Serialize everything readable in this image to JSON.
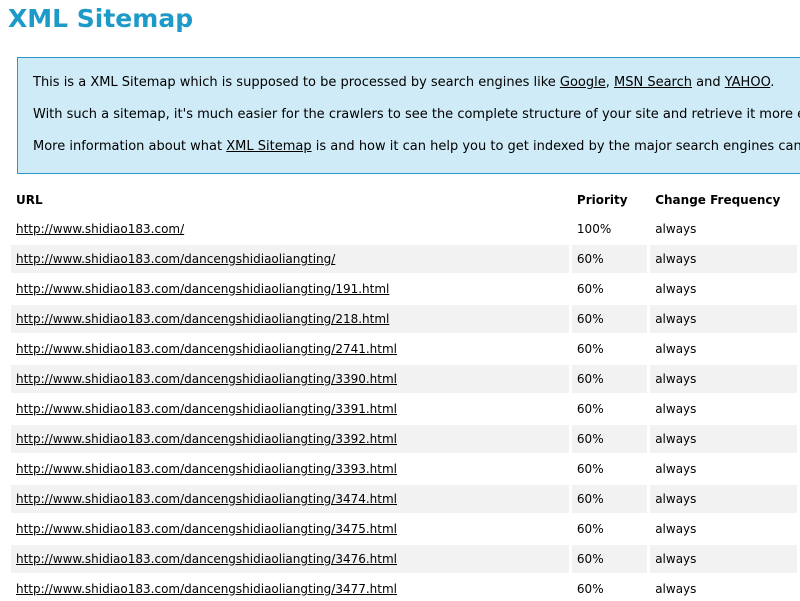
{
  "title": "XML Sitemap",
  "intro": {
    "line1": {
      "before": "This is a XML Sitemap which is supposed to be processed by search engines like ",
      "link1": "Google",
      "sep1": ", ",
      "link2": "MSN Search",
      "sep2": " and ",
      "link3": "YAHOO",
      "after": "."
    },
    "line2": "With such a sitemap, it's much easier for the crawlers to see the complete structure of your site and retrieve it more effici",
    "line3": {
      "before": "More information about what ",
      "link": "XML Sitemap",
      "after": " is and how it can help you to get indexed by the major search engines can be f"
    }
  },
  "table": {
    "headers": {
      "url": "URL",
      "priority": "Priority",
      "frequency": "Change Frequency"
    },
    "rows": [
      {
        "url": "http://www.shidiao183.com/",
        "priority": "100%",
        "frequency": "always"
      },
      {
        "url": "http://www.shidiao183.com/dancengshidiaoliangting/",
        "priority": "60%",
        "frequency": "always"
      },
      {
        "url": "http://www.shidiao183.com/dancengshidiaoliangting/191.html",
        "priority": "60%",
        "frequency": "always"
      },
      {
        "url": "http://www.shidiao183.com/dancengshidiaoliangting/218.html",
        "priority": "60%",
        "frequency": "always"
      },
      {
        "url": "http://www.shidiao183.com/dancengshidiaoliangting/2741.html",
        "priority": "60%",
        "frequency": "always"
      },
      {
        "url": "http://www.shidiao183.com/dancengshidiaoliangting/3390.html",
        "priority": "60%",
        "frequency": "always"
      },
      {
        "url": "http://www.shidiao183.com/dancengshidiaoliangting/3391.html",
        "priority": "60%",
        "frequency": "always"
      },
      {
        "url": "http://www.shidiao183.com/dancengshidiaoliangting/3392.html",
        "priority": "60%",
        "frequency": "always"
      },
      {
        "url": "http://www.shidiao183.com/dancengshidiaoliangting/3393.html",
        "priority": "60%",
        "frequency": "always"
      },
      {
        "url": "http://www.shidiao183.com/dancengshidiaoliangting/3474.html",
        "priority": "60%",
        "frequency": "always"
      },
      {
        "url": "http://www.shidiao183.com/dancengshidiaoliangting/3475.html",
        "priority": "60%",
        "frequency": "always"
      },
      {
        "url": "http://www.shidiao183.com/dancengshidiaoliangting/3476.html",
        "priority": "60%",
        "frequency": "always"
      },
      {
        "url": "http://www.shidiao183.com/dancengshidiaoliangting/3477.html",
        "priority": "60%",
        "frequency": "always"
      }
    ]
  },
  "colors": {
    "title": "#1e9ac9",
    "intro_background": "#cfebf7",
    "intro_border": "#2a9ac4",
    "alt_row": "#f2f2f2"
  }
}
